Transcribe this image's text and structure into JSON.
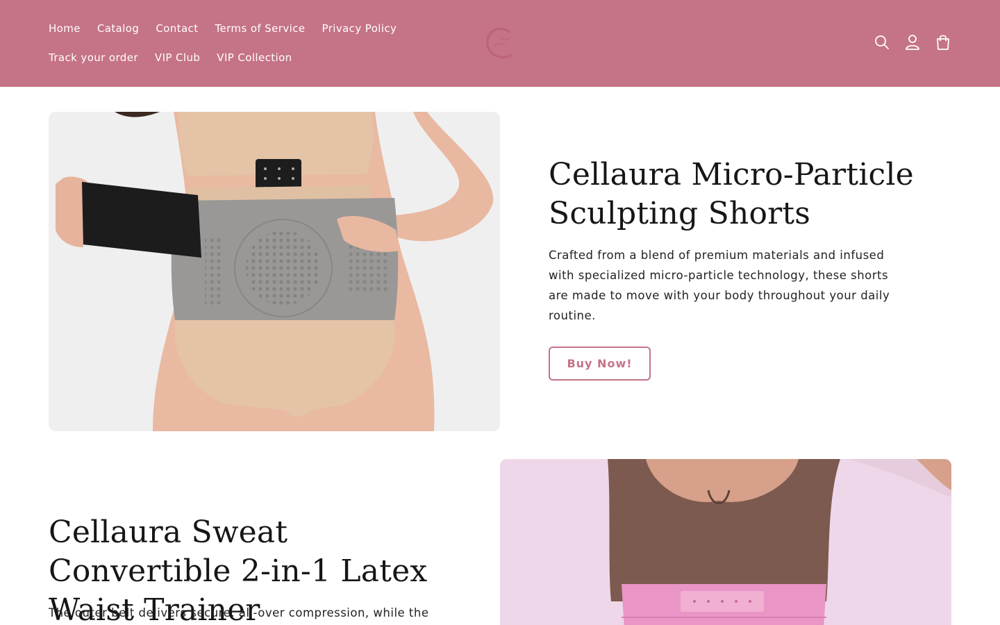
{
  "header": {
    "nav_row1": [
      {
        "label": "Home"
      },
      {
        "label": "Catalog"
      },
      {
        "label": "Contact"
      },
      {
        "label": "Terms of Service"
      },
      {
        "label": "Privacy Policy"
      }
    ],
    "nav_row2": [
      {
        "label": "Track your order"
      },
      {
        "label": "VIP Club"
      },
      {
        "label": "VIP Collection"
      }
    ],
    "icons": [
      "search-icon",
      "account-icon",
      "cart-icon"
    ],
    "background_color": "#c57386"
  },
  "products": [
    {
      "title": "Cellaura Micro-Particle Sculpting Shorts",
      "description": "Crafted from a blend of premium materials and infused with specialized micro-particle technology, these shorts are made to move with your body throughout your daily routine.",
      "button_label": "Buy Now!"
    },
    {
      "title": "Cellaura Sweat Convertible 2-in-1 Latex Waist Trainer",
      "description": "The outer belt delivers secure, all-over compression, while the"
    }
  ],
  "accent_color": "#c57386"
}
